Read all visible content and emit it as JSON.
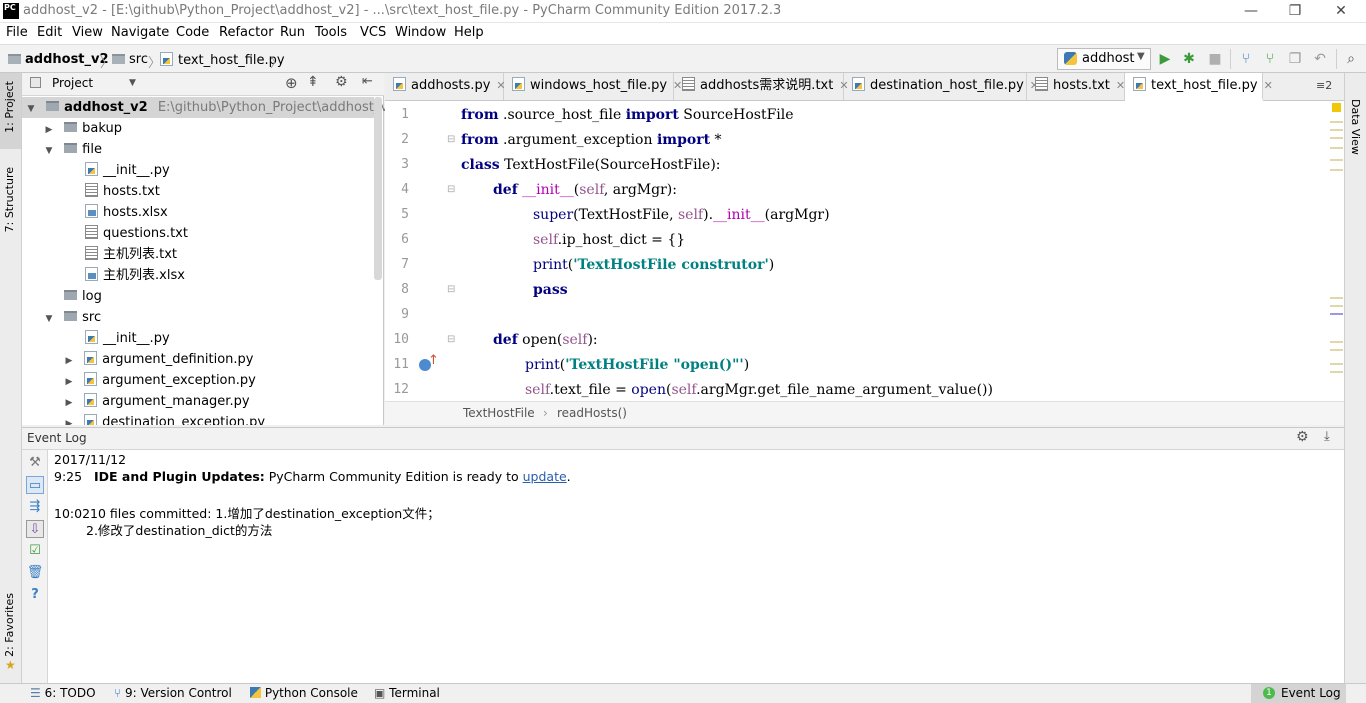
{
  "window": {
    "title": "addhost_v2 - [E:\\github\\Python_Project\\addhost_v2] - ...\\src\\text_host_file.py - PyCharm Community Edition 2017.2.3",
    "app_icon": "PC",
    "minimize": "—",
    "maximize": "❐",
    "close": "✕"
  },
  "menu": [
    "File",
    "Edit",
    "View",
    "Navigate",
    "Code",
    "Refactor",
    "Run",
    "Tools",
    "VCS",
    "Window",
    "Help"
  ],
  "navbar": {
    "crumbs": [
      "addhost_v2",
      "src",
      "text_host_file.py"
    ],
    "run_config": "addhost"
  },
  "left_strip": {
    "project_tab": "1: Project",
    "structure_tab": "7: Structure",
    "favorites_tab": "2: Favorites"
  },
  "right_strip": {
    "data_view_tab": "Data View"
  },
  "project": {
    "title": "Project",
    "tree": [
      {
        "label": "addhost_v2",
        "path": "E:\\github\\Python_Project\\addhost_v2"
      },
      {
        "label": "bakup"
      },
      {
        "label": "file"
      },
      {
        "label": "__init__.py"
      },
      {
        "label": "hosts.txt"
      },
      {
        "label": "hosts.xlsx"
      },
      {
        "label": "questions.txt"
      },
      {
        "label": "主机列表.txt"
      },
      {
        "label": "主机列表.xlsx"
      },
      {
        "label": "log"
      },
      {
        "label": "src"
      },
      {
        "label": "__init__.py"
      },
      {
        "label": "argument_definition.py"
      },
      {
        "label": "argument_exception.py"
      },
      {
        "label": "argument_manager.py"
      },
      {
        "label": "destination_exception.py"
      }
    ]
  },
  "editor": {
    "tabs": [
      "addhosts.py",
      "windows_host_file.py",
      "addhosts需求说明.txt",
      "destination_host_file.py",
      "hosts.txt",
      "text_host_file.py"
    ],
    "tab_overflow": "≡2",
    "line_numbers": [
      "1",
      "2",
      "3",
      "4",
      "5",
      "6",
      "7",
      "8",
      "9",
      "10",
      "11",
      "12"
    ],
    "breadcrumb": [
      "TextHostFile",
      "readHosts()"
    ],
    "code": {
      "l1": [
        "from",
        " .source_host_file ",
        "import",
        " SourceHostFile"
      ],
      "l2": [
        "from",
        " .argument_exception ",
        "import",
        " *"
      ],
      "l3": [
        "class",
        " TextHostFile(SourceHostFile):"
      ],
      "l4": [
        "def",
        "__init__",
        "(",
        "self",
        ", argMgr):"
      ],
      "l5": [
        "super",
        "(TextHostFile, ",
        "self",
        ").",
        "__init__",
        "(argMgr)"
      ],
      "l6": [
        "self",
        ".ip_host_dict = {}"
      ],
      "l7": [
        "print",
        "(",
        "'TextHostFile construtor'",
        ")"
      ],
      "l8": [
        "pass"
      ],
      "l10": [
        "def",
        " open(",
        "self",
        "):"
      ],
      "l11": [
        "print",
        "(",
        "'TextHostFile \"open()\"'",
        ")"
      ],
      "l12": [
        "self",
        ".text_file = ",
        "open",
        "(",
        "self",
        ".argMgr.get_file_name_argument_value())"
      ]
    }
  },
  "event_log": {
    "title": "Event Log",
    "date": "2017/11/12",
    "entry1_time": "9:25",
    "entry1_title": "IDE and Plugin Updates:",
    "entry1_text": "PyCharm Community Edition is ready to",
    "entry1_link": "update",
    "entry1_end": ".",
    "entry2_time": "10:02",
    "entry2_text": "10 files committed: 1.增加了destination_exception文件；",
    "entry2_cont": "2.修改了destination_dict的方法"
  },
  "statusbar": {
    "todo": "6: TODO",
    "vcs": "9: Version Control",
    "console": "Python Console",
    "terminal": "Terminal",
    "event_log_count": "1",
    "event_log": "Event Log"
  }
}
